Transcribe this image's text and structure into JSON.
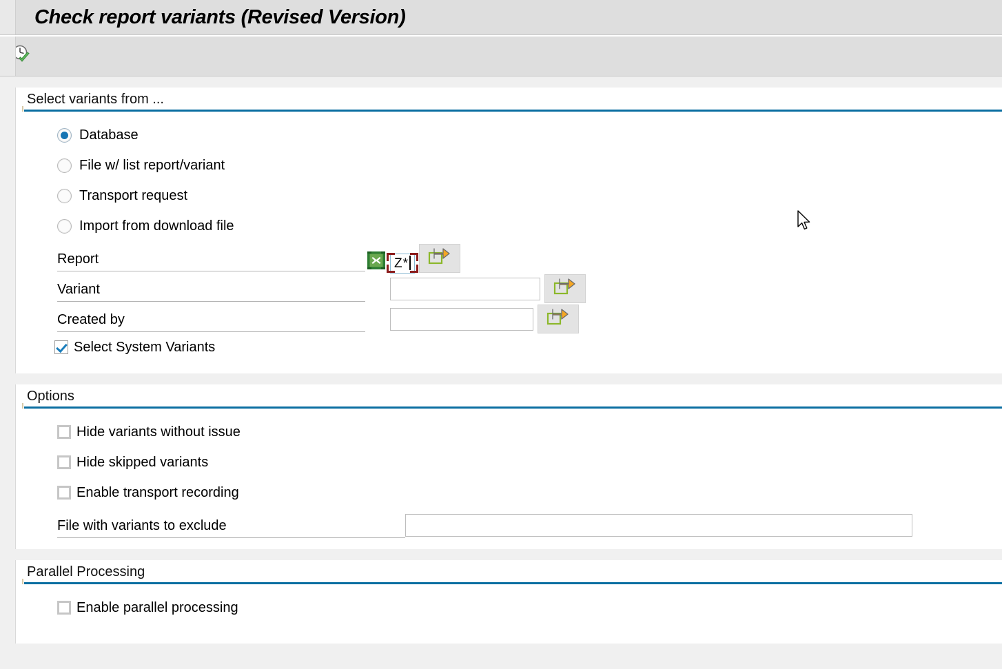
{
  "window": {
    "title": "Check report variants (Revised Version)"
  },
  "toolbar": {
    "buttons": [
      {
        "name": "execute-check-button",
        "icon": "clock-check-icon",
        "tooltip": "Execute"
      }
    ]
  },
  "sections": {
    "select_variants": {
      "header": "Select variants from ...",
      "radios": [
        {
          "label": "Database",
          "selected": true
        },
        {
          "label": "File w/ list report/variant",
          "selected": false
        },
        {
          "label": "Transport request",
          "selected": false
        },
        {
          "label": "Import from download file",
          "selected": false
        }
      ],
      "fields": [
        {
          "label": "Report",
          "value": "Z*",
          "placeholder": "",
          "focused": true,
          "has_multi_icon": true,
          "multi_icon": "green-x-multiselect-icon",
          "select_button": "multiple-selection-arrow-icon"
        },
        {
          "label": "Variant",
          "value": "",
          "placeholder": "",
          "focused": false,
          "has_multi_icon": false,
          "select_button": "multiple-selection-arrow-icon"
        },
        {
          "label": "Created by",
          "value": "",
          "placeholder": "",
          "focused": false,
          "has_multi_icon": false,
          "select_button": "multiple-selection-arrow-icon"
        }
      ],
      "checkbox": {
        "label": "Select System Variants",
        "checked": true
      }
    },
    "options": {
      "header": "Options",
      "checkboxes": [
        {
          "label": "Hide variants without issue",
          "checked": false
        },
        {
          "label": "Hide skipped variants",
          "checked": false
        },
        {
          "label": "Enable transport recording",
          "checked": false
        }
      ],
      "field": {
        "label": "File with variants to exclude",
        "value": "",
        "placeholder": ""
      }
    },
    "parallel": {
      "header": "Parallel Processing",
      "checkboxes": [
        {
          "label": "Enable parallel processing",
          "checked": false
        }
      ]
    }
  },
  "colors": {
    "section_rule": "#0a6ea1",
    "radio_fill": "#1574b3",
    "checkbox_check": "#1b7ebc",
    "focus_bracket": "#8b1c1c",
    "window_bg": "#f0f0f0"
  }
}
